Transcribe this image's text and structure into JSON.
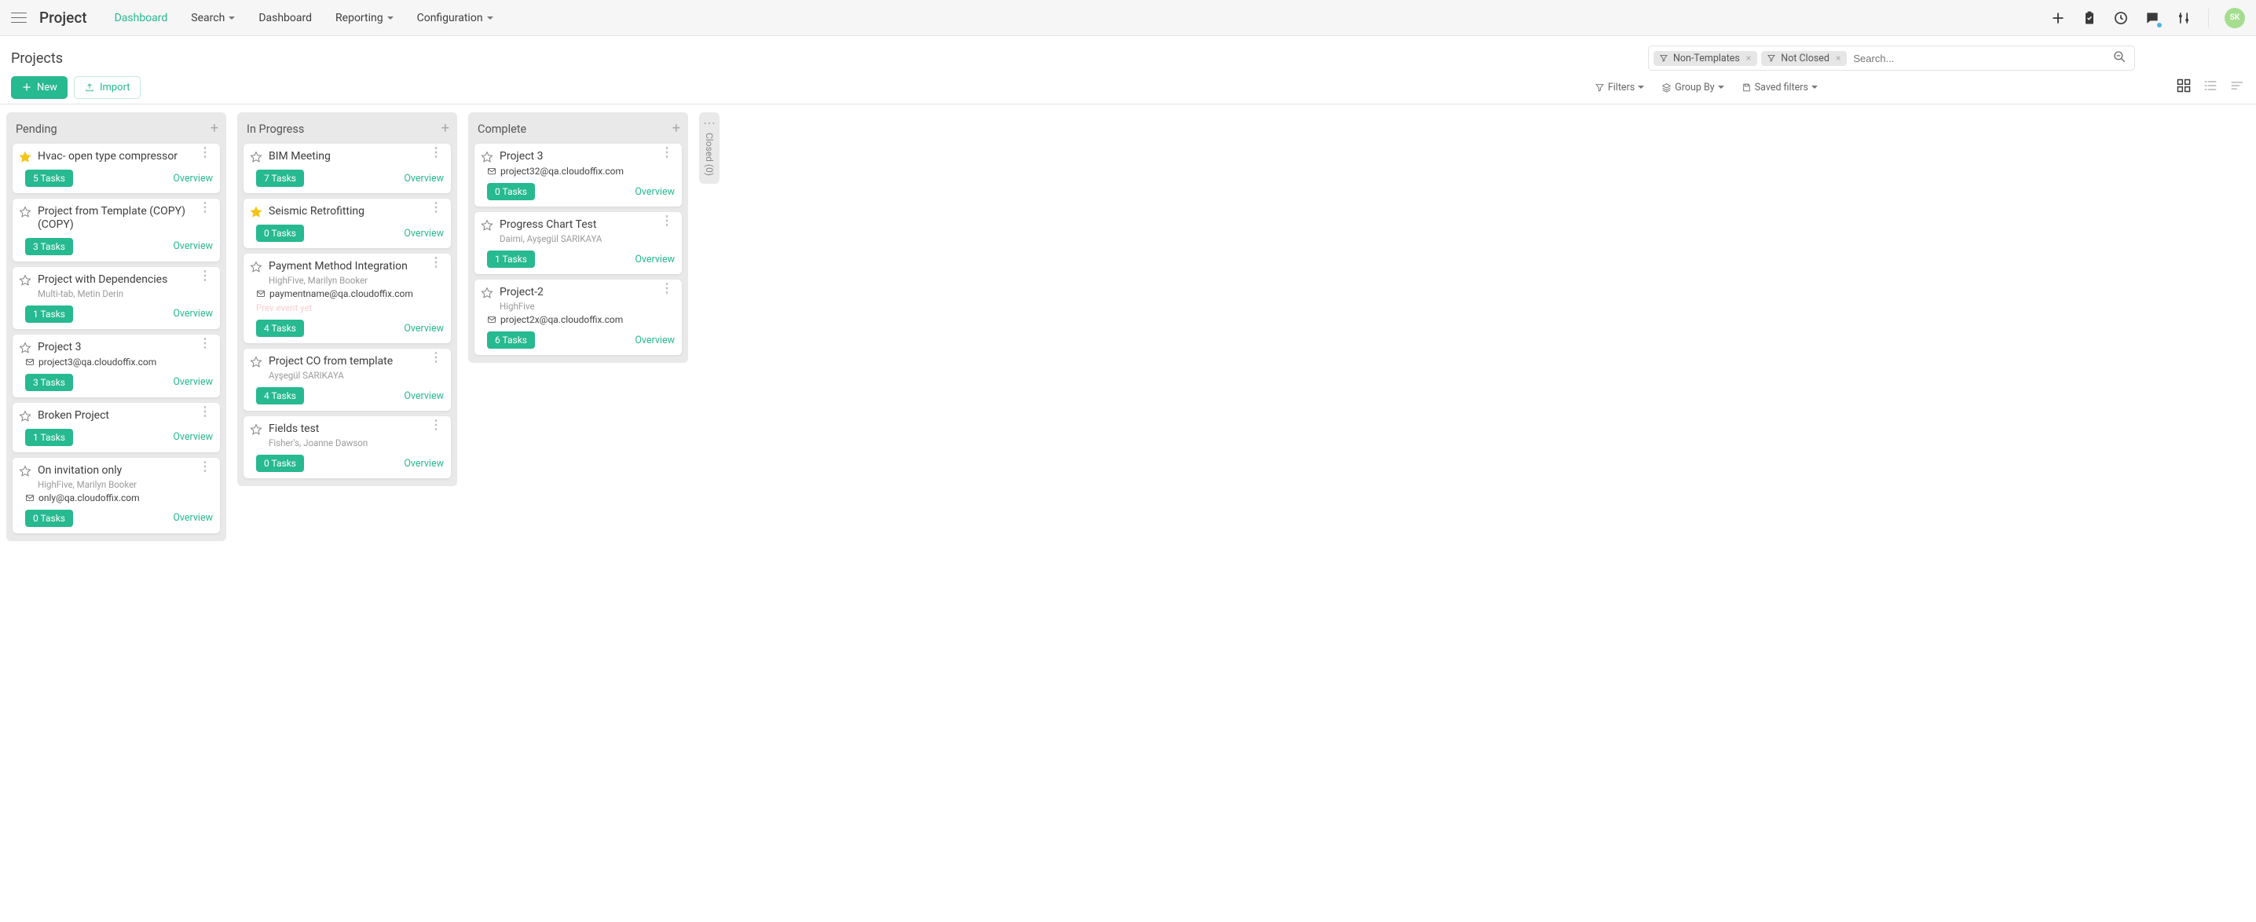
{
  "header": {
    "brand": "Project",
    "menu": [
      {
        "label": "Dashboard",
        "active": true,
        "caret": false
      },
      {
        "label": "Search",
        "active": false,
        "caret": true
      },
      {
        "label": "Dashboard",
        "active": false,
        "caret": false
      },
      {
        "label": "Reporting",
        "active": false,
        "caret": true
      },
      {
        "label": "Configuration",
        "active": false,
        "caret": true
      }
    ],
    "avatar_initials": "SK"
  },
  "page": {
    "title": "Projects",
    "search_placeholder": "Search...",
    "filter_chips": [
      {
        "label": "Non-Templates"
      },
      {
        "label": "Not Closed"
      }
    ],
    "new_btn": "New",
    "import_btn": "Import",
    "tool_filters": "Filters",
    "tool_group_by": "Group By",
    "tool_saved_filters": "Saved filters"
  },
  "board": {
    "overview_label": "Overview",
    "collapsed_column": {
      "label": "Closed (0)"
    },
    "columns": [
      {
        "title": "Pending",
        "cards": [
          {
            "starred": true,
            "title": "Hvac- open type compressor",
            "subtitle": "",
            "email": "",
            "tasks": "5 Tasks"
          },
          {
            "starred": false,
            "title": "Project from Template (COPY) (COPY)",
            "subtitle": "",
            "email": "",
            "tasks": "3 Tasks"
          },
          {
            "starred": false,
            "title": "Project with Dependencies",
            "subtitle": "Multi-tab, Metin Derin",
            "email": "",
            "tasks": "1 Tasks"
          },
          {
            "starred": false,
            "title": "Project 3",
            "subtitle": "",
            "email": "project3@qa.cloudoffix.com",
            "tasks": "3 Tasks"
          },
          {
            "starred": false,
            "title": "Broken Project",
            "subtitle": "",
            "email": "",
            "tasks": "1 Tasks"
          },
          {
            "starred": false,
            "title": "On invitation only",
            "subtitle": "HighFive, Marilyn Booker",
            "email": "only@qa.cloudoffix.com",
            "tasks": "0 Tasks"
          }
        ]
      },
      {
        "title": "In Progress",
        "cards": [
          {
            "starred": false,
            "title": "BIM Meeting",
            "subtitle": "",
            "email": "",
            "tasks": "7 Tasks"
          },
          {
            "starred": true,
            "title": "Seismic Retrofitting",
            "subtitle": "",
            "email": "",
            "tasks": "0 Tasks"
          },
          {
            "starred": false,
            "title": "Payment Method Integration",
            "subtitle": "HighFive, Marilyn Booker",
            "email": "paymentname@qa.cloudoffix.com",
            "tasks": "4 Tasks",
            "faded_note": "Prev event yet"
          },
          {
            "starred": false,
            "title": "Project CO from template",
            "subtitle": "Ayşegül SARIKAYA",
            "email": "",
            "tasks": "4 Tasks"
          },
          {
            "starred": false,
            "title": "Fields test",
            "subtitle": "Fisher's, Joanne Dawson",
            "email": "",
            "tasks": "0 Tasks"
          }
        ]
      },
      {
        "title": "Complete",
        "cards": [
          {
            "starred": false,
            "title": "Project 3",
            "subtitle": "",
            "email": "project32@qa.cloudoffix.com",
            "tasks": "0 Tasks"
          },
          {
            "starred": false,
            "title": "Progress Chart Test",
            "subtitle": "Daimi, Ayşegül SARIKAYA",
            "email": "",
            "tasks": "1 Tasks"
          },
          {
            "starred": false,
            "title": "Project-2",
            "subtitle": "HighFive",
            "email": "project2x@qa.cloudoffix.com",
            "tasks": "6 Tasks"
          }
        ]
      }
    ]
  }
}
